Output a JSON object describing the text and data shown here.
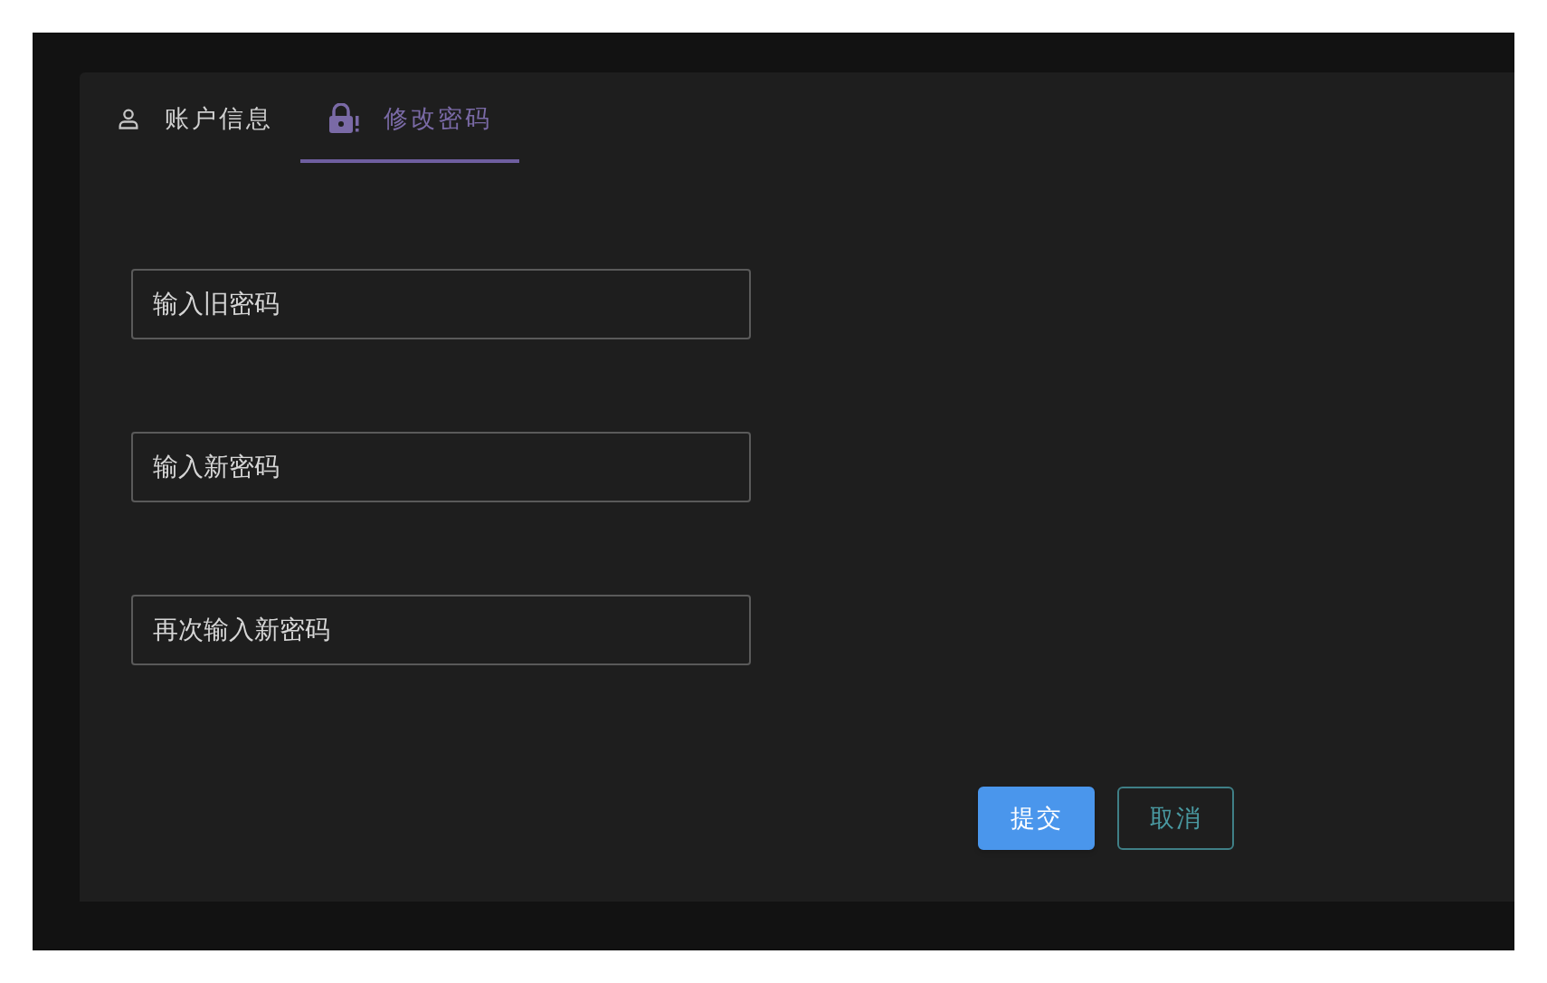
{
  "tabs": [
    {
      "label": "账户信息",
      "kind": "user",
      "selected": false
    },
    {
      "label": "修改密码",
      "kind": "lock",
      "selected": true
    }
  ],
  "fields": [
    {
      "placeholder": "输入旧密码"
    },
    {
      "placeholder": "输入新密码"
    },
    {
      "placeholder": "再次输入新密码"
    }
  ],
  "buttons": [
    {
      "label": "提交",
      "kind": "primary"
    },
    {
      "label": "取消",
      "kind": "outline"
    }
  ]
}
